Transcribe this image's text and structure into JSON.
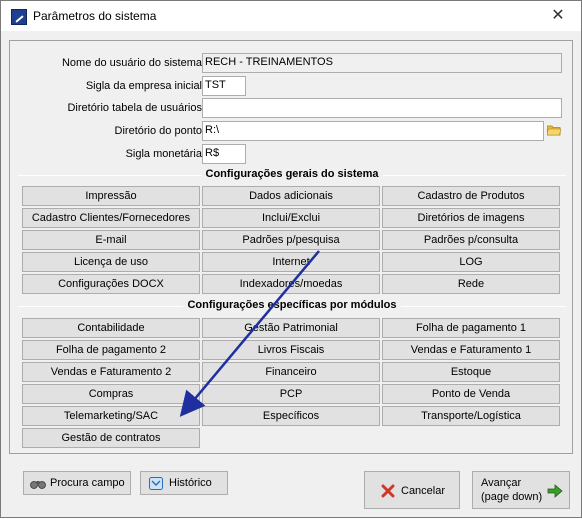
{
  "window": {
    "title": "Parâmetros do sistema",
    "close_glyph": "✕"
  },
  "fields": [
    {
      "label": "Nome do usuário do sistema",
      "value": "RECH - TREINAMENTOS"
    },
    {
      "label": "Sigla da empresa inicial",
      "value": "TST"
    },
    {
      "label": "Diretório tabela de usuários",
      "value": ""
    },
    {
      "label": "Diretório do ponto",
      "value": "R:\\"
    },
    {
      "label": "Sigla monetária",
      "value": "R$"
    }
  ],
  "general_section": {
    "title": "Configurações gerais do sistema",
    "buttons": [
      "Impressão",
      "Dados adicionais",
      "Cadastro de Produtos",
      "Cadastro Clientes/Fornecedores",
      "Inclui/Exclui",
      "Diretórios de imagens",
      "E-mail",
      "Padrões p/pesquisa",
      "Padrões p/consulta",
      "Licença de uso",
      "Internet",
      "LOG",
      "Configurações DOCX",
      "Indexadores/moedas",
      "Rede"
    ]
  },
  "modules_section": {
    "title": "Configurações específicas por módulos",
    "buttons": [
      "Contabilidade",
      "Gestão Patrimonial",
      "Folha de pagamento 1",
      "Folha de pagamento 2",
      "Livros Fiscais",
      "Vendas e Faturamento 1",
      "Vendas e Faturamento 2",
      "Financeiro",
      "Estoque",
      "Compras",
      "PCP",
      "Ponto de Venda",
      "Telemarketing/SAC",
      "Específicos",
      "Transporte/Logística",
      "Gestão de contratos"
    ]
  },
  "footer": {
    "search_field_label": "Procura campo",
    "history_label": "Histórico",
    "cancel_label": "Cancelar",
    "next_label_line1": "Avançar",
    "next_label_line2": "(page down)"
  },
  "icons": {
    "app": "app-icon",
    "folder": "folder-icon",
    "search": "binoculars-icon",
    "history": "history-icon",
    "cancel": "cancel-x-icon",
    "next": "green-arrow-right-icon"
  },
  "colors": {
    "annotation_arrow": "#1f2fa0",
    "cancel_red": "#d0362a",
    "next_green": "#3a9c2a"
  }
}
